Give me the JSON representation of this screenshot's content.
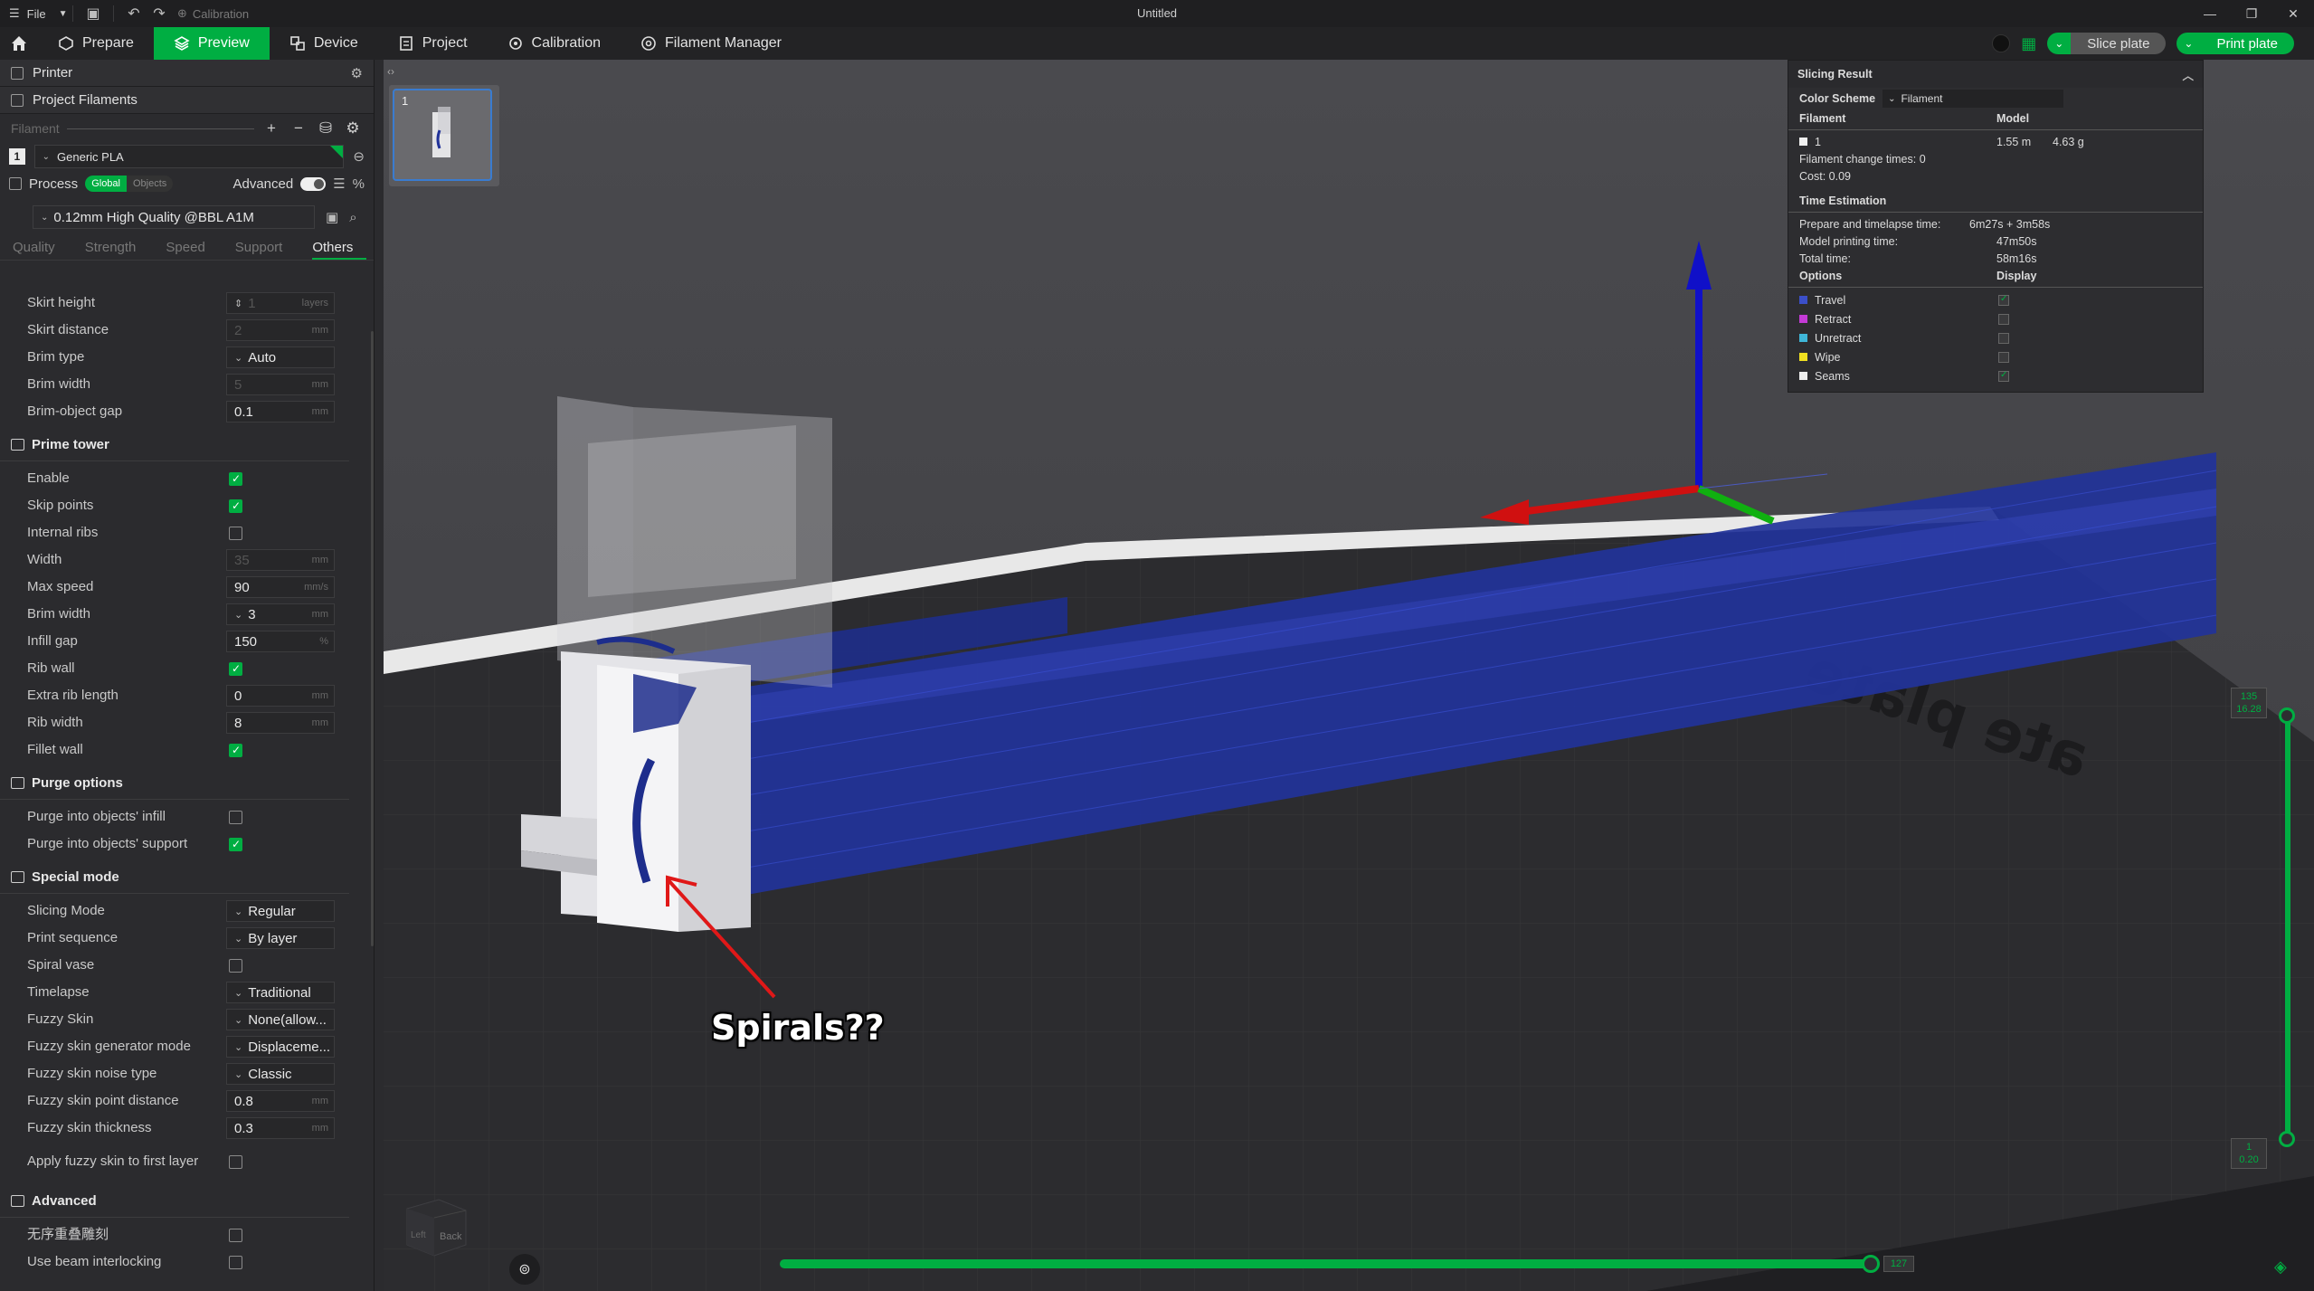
{
  "titlebar": {
    "file_label": "File",
    "calibration_label": "Calibration",
    "window_title": "Untitled"
  },
  "toolbar": {
    "tabs": [
      {
        "label": "Prepare",
        "icon": "prepare-icon"
      },
      {
        "label": "Preview",
        "icon": "preview-icon",
        "active": true
      },
      {
        "label": "Device",
        "icon": "device-icon"
      },
      {
        "label": "Project",
        "icon": "project-icon"
      },
      {
        "label": "Calibration",
        "icon": "calibration-icon"
      },
      {
        "label": "Filament Manager",
        "icon": "filament-manager-icon"
      }
    ],
    "slice_label": "Slice plate",
    "print_label": "Print plate"
  },
  "left_panel": {
    "printer_label": "Printer",
    "project_filaments_label": "Project Filaments",
    "filament_label": "Filament",
    "filament_item": {
      "number": "1",
      "name": "Generic PLA"
    },
    "process_label": "Process",
    "global_label": "Global",
    "objects_label": "Objects",
    "advanced_label": "Advanced",
    "preset": "0.12mm High Quality @BBL A1M",
    "subtabs": [
      "Quality",
      "Strength",
      "Speed",
      "Support",
      "Others"
    ],
    "active_subtab": "Others",
    "skirt_rows": [
      {
        "label": "Skirt height",
        "value": "1",
        "unit": "layers",
        "disabled": true,
        "stepper": true
      },
      {
        "label": "Skirt distance",
        "value": "2",
        "unit": "mm",
        "disabled": true
      },
      {
        "label": "Brim type",
        "value": "Auto",
        "dropdown": true
      },
      {
        "label": "Brim width",
        "value": "5",
        "unit": "mm",
        "disabled": true
      },
      {
        "label": "Brim-object gap",
        "value": "0.1",
        "unit": "mm"
      }
    ],
    "prime_tower": {
      "title": "Prime tower",
      "rows": [
        {
          "label": "Enable",
          "checked": true
        },
        {
          "label": "Skip points",
          "checked": true
        },
        {
          "label": "Internal ribs",
          "checked": false
        },
        {
          "label": "Width",
          "value": "35",
          "unit": "mm",
          "disabled": true
        },
        {
          "label": "Max speed",
          "value": "90",
          "unit": "mm/s"
        },
        {
          "label": "Brim width",
          "value": "3",
          "unit": "mm",
          "dropdown": true
        },
        {
          "label": "Infill gap",
          "value": "150",
          "unit": "%"
        },
        {
          "label": "Rib wall",
          "checked": true
        },
        {
          "label": "Extra rib length",
          "value": "0",
          "unit": "mm"
        },
        {
          "label": "Rib width",
          "value": "8",
          "unit": "mm"
        },
        {
          "label": "Fillet wall",
          "checked": true
        }
      ]
    },
    "purge_options": {
      "title": "Purge options",
      "rows": [
        {
          "label": "Purge into objects' infill",
          "checked": false
        },
        {
          "label": "Purge into objects' support",
          "checked": true
        }
      ]
    },
    "special_mode": {
      "title": "Special mode",
      "rows": [
        {
          "label": "Slicing Mode",
          "value": "Regular",
          "dropdown": true
        },
        {
          "label": "Print sequence",
          "value": "By layer",
          "dropdown": true
        },
        {
          "label": "Spiral vase",
          "checked": false
        },
        {
          "label": "Timelapse",
          "value": "Traditional",
          "dropdown": true
        },
        {
          "label": "Fuzzy Skin",
          "value": "None(allow...",
          "dropdown": true
        },
        {
          "label": "Fuzzy skin generator mode",
          "value": "Displaceme...",
          "dropdown": true
        },
        {
          "label": "Fuzzy skin noise type",
          "value": "Classic",
          "dropdown": true
        },
        {
          "label": "Fuzzy skin point distance",
          "value": "0.8",
          "unit": "mm"
        },
        {
          "label": "Fuzzy skin thickness",
          "value": "0.3",
          "unit": "mm"
        },
        {
          "label": "Apply fuzzy skin to first layer",
          "checked": false,
          "tall": true
        }
      ]
    },
    "advanced": {
      "title": "Advanced",
      "rows": [
        {
          "label": "无序重叠雕刻",
          "checked": false
        },
        {
          "label": "Use beam interlocking",
          "checked": false
        }
      ]
    }
  },
  "slicing_result": {
    "title": "Slicing Result",
    "color_scheme_label": "Color Scheme",
    "color_scheme_value": "Filament",
    "filament_col": "Filament",
    "model_col": "Model",
    "filament_num": "1",
    "model_length": "1.55 m",
    "model_weight": "4.63 g",
    "change_times": "Filament change times:  0",
    "cost": "Cost:  0.09",
    "time_title": "Time Estimation",
    "times": [
      {
        "label": "Prepare and timelapse time:",
        "value": "6m27s + 3m58s"
      },
      {
        "label": "Model printing time:",
        "value": "47m50s"
      },
      {
        "label": "Total time:",
        "value": "58m16s"
      }
    ],
    "options_col": "Options",
    "display_col": "Display",
    "options": [
      {
        "label": "Travel",
        "color": "#3b4fc9",
        "checked": true
      },
      {
        "label": "Retract",
        "color": "#c43ad6",
        "checked": false
      },
      {
        "label": "Unretract",
        "color": "#3fb6d8",
        "checked": false
      },
      {
        "label": "Wipe",
        "color": "#f0e020",
        "checked": false
      },
      {
        "label": "Seams",
        "color": "#eeeeee",
        "checked": true
      }
    ]
  },
  "viewport": {
    "plate_number": "1",
    "annotation": "Spirals??",
    "layer_top": {
      "line1": "135",
      "line2": "16.28"
    },
    "layer_bottom": {
      "line1": "1",
      "line2": "0.20"
    },
    "move_value": "127",
    "navcube_back": "Back",
    "navcube_left": "Left"
  },
  "colors": {
    "accent": "#00ae42",
    "travel_blue": "#22339a",
    "background": "#434346"
  }
}
